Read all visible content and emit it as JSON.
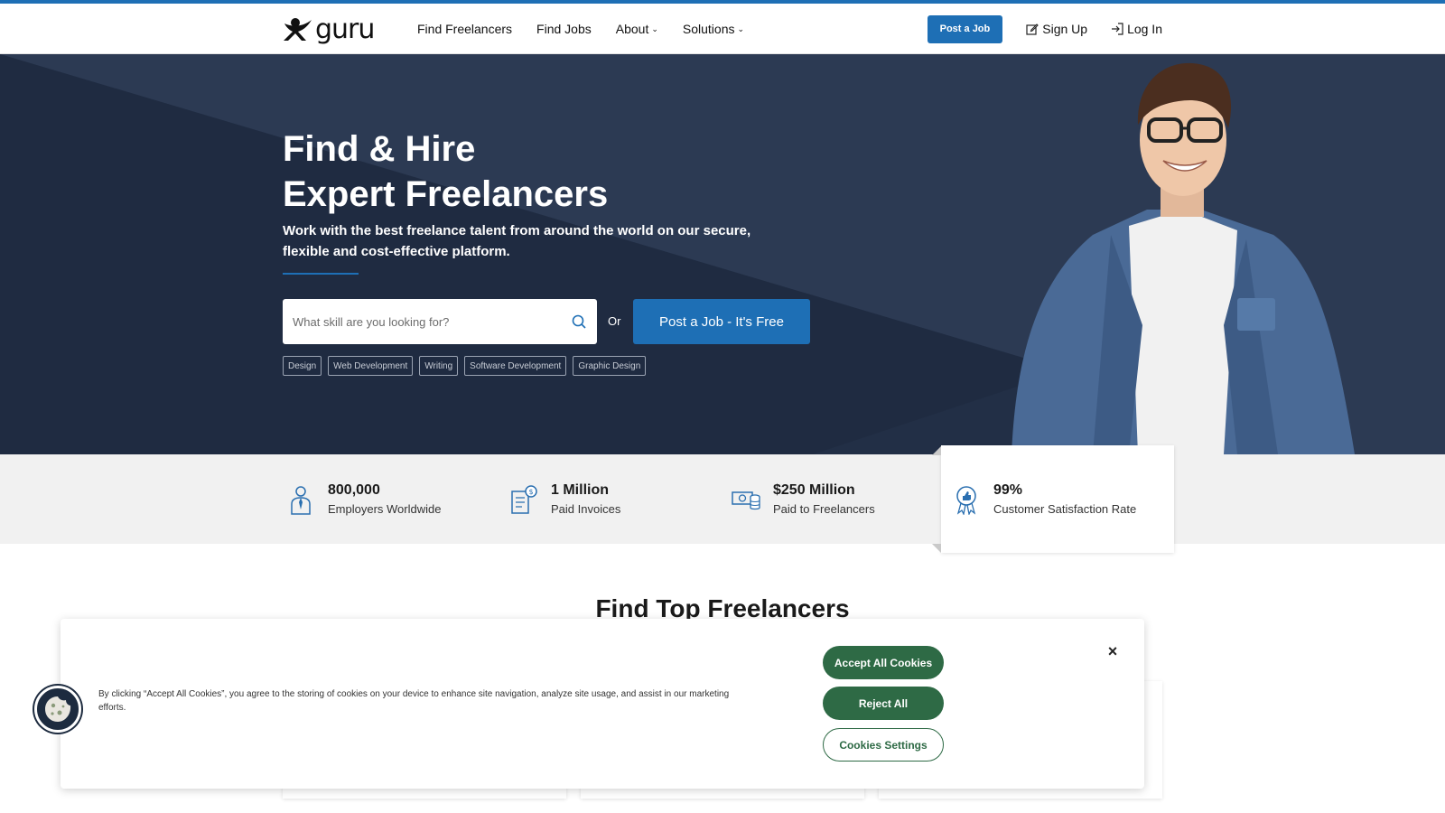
{
  "header": {
    "logo_text": "guru",
    "nav": {
      "find_freelancers": "Find Freelancers",
      "find_jobs": "Find Jobs",
      "about": "About",
      "solutions": "Solutions"
    },
    "post_job": "Post a Job",
    "sign_up": "Sign Up",
    "log_in": "Log In"
  },
  "hero": {
    "title_line1": "Find & Hire",
    "title_line2": "Expert Freelancers",
    "subtitle": "Work with the best freelance talent from around the world on our secure, flexible and cost-effective platform.",
    "search_placeholder": "What skill are you looking for?",
    "or": "Or",
    "cta": "Post a Job - It's Free",
    "tags": [
      "Design",
      "Web Development",
      "Writing",
      "Software Development",
      "Graphic Design"
    ]
  },
  "stats": [
    {
      "value": "800,000",
      "label": "Employers Worldwide",
      "icon": "employer-icon"
    },
    {
      "value": "1 Million",
      "label": "Paid Invoices",
      "icon": "invoice-icon"
    },
    {
      "value": "$250 Million",
      "label": "Paid to Freelancers",
      "icon": "money-icon"
    },
    {
      "value": "99%",
      "label": "Customer Satisfaction Rate",
      "icon": "award-icon"
    }
  ],
  "section": {
    "title": "Find Top Freelancers"
  },
  "cookie": {
    "text": "By clicking “Accept All Cookies”, you agree to the storing of cookies on your device to enhance site navigation, analyze site usage, and assist in our marketing efforts.",
    "accept": "Accept All Cookies",
    "reject": "Reject All",
    "settings": "Cookies Settings",
    "close": "×"
  },
  "colors": {
    "brand_blue": "#1e6fb5",
    "hero_bg": "#222f46",
    "cookie_green": "#2e6a45"
  }
}
